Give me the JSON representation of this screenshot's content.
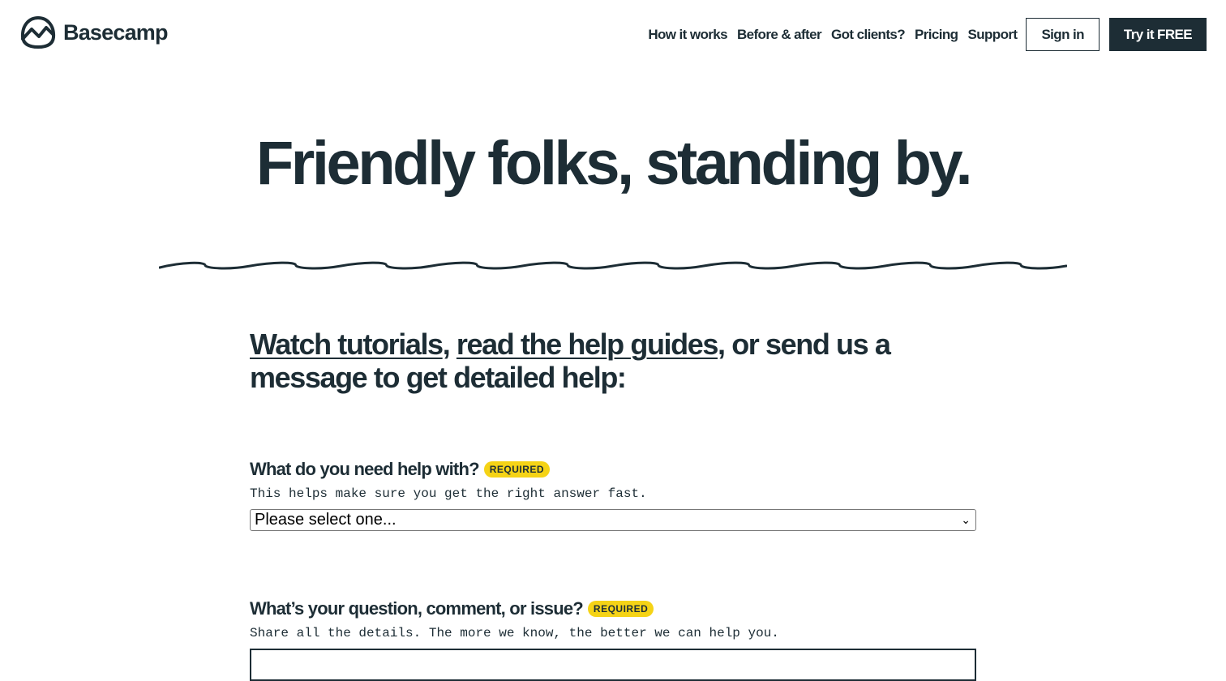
{
  "header": {
    "logo_text": "Basecamp",
    "nav": [
      {
        "label": "How it works"
      },
      {
        "label": "Before & after"
      },
      {
        "label": "Got clients?"
      },
      {
        "label": "Pricing"
      },
      {
        "label": "Support"
      }
    ],
    "sign_in_label": "Sign in",
    "try_label": "Try it FREE"
  },
  "hero": {
    "title": "Friendly folks, standing by."
  },
  "intro": {
    "link1": "Watch tutorials",
    "sep1": ", ",
    "link2": "read the help guides",
    "rest": ", or send us a message to get detailed help:"
  },
  "form": {
    "topic": {
      "label": "What do you need help with?",
      "badge": "REQUIRED",
      "hint": "This helps make sure you get the right answer fast.",
      "selected": "Please select one..."
    },
    "question": {
      "label": "What’s your question, comment, or issue?",
      "badge": "REQUIRED",
      "hint": "Share all the details. The more we know, the better we can help you."
    }
  },
  "colors": {
    "text": "#1d2d35",
    "badge_bg": "#f5d316",
    "button_bg": "#1d2d35"
  }
}
